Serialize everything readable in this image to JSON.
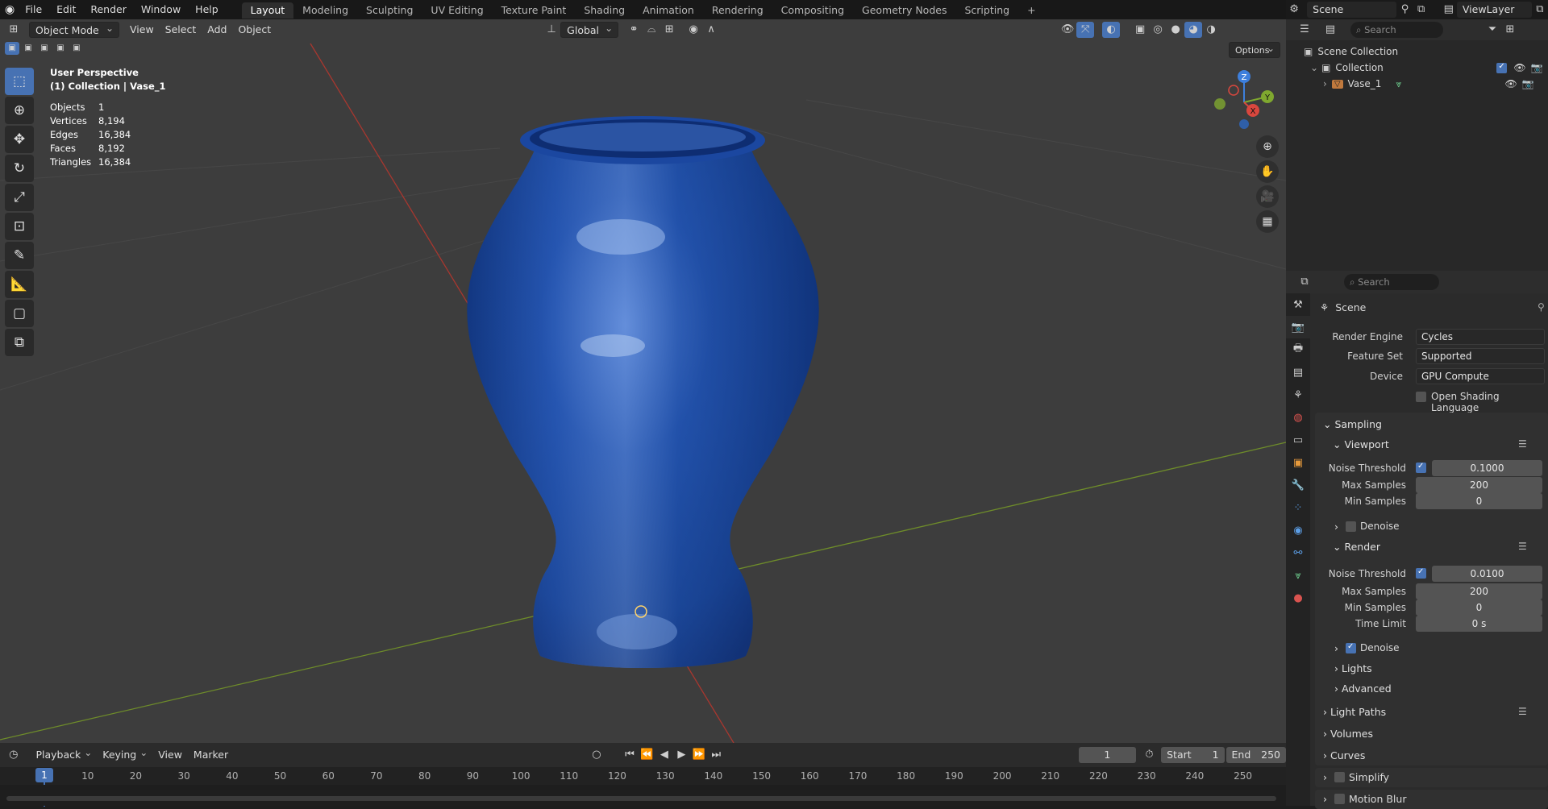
{
  "topbar": {
    "menus": [
      "File",
      "Edit",
      "Render",
      "Window",
      "Help"
    ],
    "workspaces": [
      "Layout",
      "Modeling",
      "Sculpting",
      "UV Editing",
      "Texture Paint",
      "Shading",
      "Animation",
      "Rendering",
      "Compositing",
      "Geometry Nodes",
      "Scripting"
    ],
    "active_workspace": "Layout",
    "scene": "Scene",
    "view_layer": "ViewLayer"
  },
  "viewport": {
    "mode": "Object Mode",
    "menus": [
      "View",
      "Select",
      "Add",
      "Object"
    ],
    "transform_orientation": "Global",
    "options_label": "Options",
    "perspective": "User Perspective",
    "collection_path": "(1) Collection | Vase_1",
    "stats": [
      {
        "label": "Objects",
        "value": "1"
      },
      {
        "label": "Vertices",
        "value": "8,194"
      },
      {
        "label": "Edges",
        "value": "16,384"
      },
      {
        "label": "Faces",
        "value": "8,192"
      },
      {
        "label": "Triangles",
        "value": "16,384"
      }
    ],
    "gizmo": {
      "z": "Z",
      "y": "Y",
      "x": "X"
    }
  },
  "outliner": {
    "search_placeholder": "Search",
    "root": "Scene Collection",
    "collection": "Collection",
    "object": "Vase_1"
  },
  "properties": {
    "search_placeholder": "Search",
    "context": "Scene",
    "render_engine_label": "Render Engine",
    "render_engine": "Cycles",
    "feature_set_label": "Feature Set",
    "feature_set": "Supported",
    "device_label": "Device",
    "device": "GPU Compute",
    "osl_label": "Open Shading Language",
    "sampling": "Sampling",
    "viewport": "Viewport",
    "noise_threshold_label": "Noise Threshold",
    "viewport_noise": "0.1000",
    "max_samples_label": "Max Samples",
    "viewport_max": "200",
    "min_samples_label": "Min Samples",
    "viewport_min": "0",
    "denoise_label": "Denoise",
    "render": "Render",
    "render_noise": "0.0100",
    "render_max": "200",
    "render_min": "0",
    "time_limit_label": "Time Limit",
    "time_limit": "0 s",
    "lights": "Lights",
    "advanced": "Advanced",
    "light_paths": "Light Paths",
    "volumes": "Volumes",
    "curves": "Curves",
    "simplify": "Simplify",
    "motion_blur": "Motion Blur"
  },
  "timeline": {
    "menus": [
      "Playback",
      "Keying",
      "View",
      "Marker"
    ],
    "current_frame": "1",
    "start_label": "Start",
    "start": "1",
    "end_label": "End",
    "end": "250",
    "ticks": [
      "1",
      "10",
      "20",
      "30",
      "40",
      "50",
      "60",
      "70",
      "80",
      "90",
      "100",
      "110",
      "120",
      "130",
      "140",
      "150",
      "160",
      "170",
      "180",
      "190",
      "200",
      "210",
      "220",
      "230",
      "240",
      "250"
    ]
  },
  "colors": {
    "accent": "#4772b3",
    "vase": "#1f4a9e",
    "x_axis": "#c0392b",
    "y_axis": "#7a9a2a"
  }
}
